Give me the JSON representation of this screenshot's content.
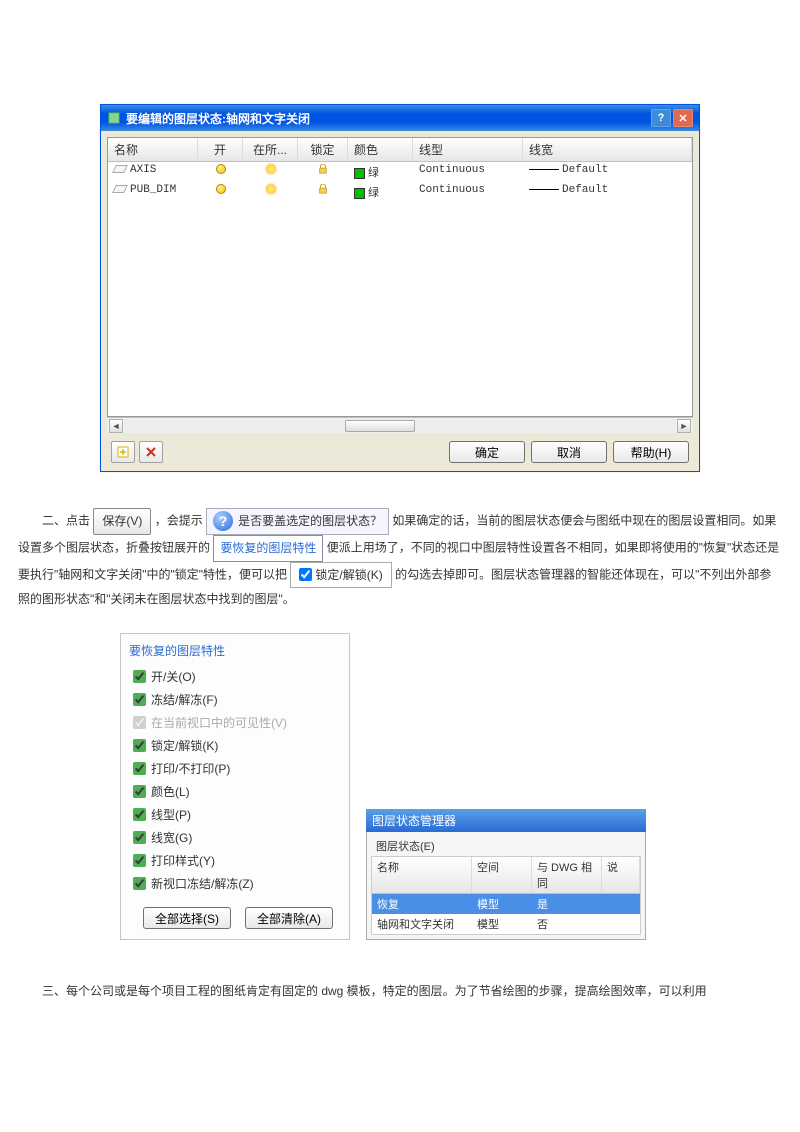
{
  "dialog": {
    "title": "要编辑的图层状态:轴网和文字关闭",
    "columns": {
      "name": "名称",
      "on": "开",
      "freeze": "在所...",
      "lock": "锁定",
      "color": "颜色",
      "linetype": "线型",
      "lineweight": "线宽"
    },
    "rows": [
      {
        "name": "AXIS",
        "color_label": "绿",
        "linetype": "Continuous",
        "lineweight": "Default"
      },
      {
        "name": "PUB_DIM",
        "color_label": "绿",
        "linetype": "Continuous",
        "lineweight": "Default"
      }
    ],
    "buttons": {
      "ok": "确定",
      "cancel": "取消",
      "help": "帮助(H)"
    }
  },
  "para2": {
    "prefix": "二、点击",
    "save_btn": "保存(V)",
    "t1": "，会提示",
    "prompt": "是否要盖选定的图层状态？",
    "t2": "如果确定的话，当前的图层状态便会与图纸中现在的图层设置相同。如果设置多个图层状态，折叠按钮展开的",
    "link1": "要恢复的图层特性",
    "t3": "便派上用场了，不同的视口中图层特性设置各不相同，如果即将使用的\"恢复\"状态还是要执行\"轴网和文字关闭\"中的\"锁定\"特性，便可以把",
    "chk_label": "锁定/解锁(K)",
    "t4": "的勾选去掉即可。图层状态管理器的智能还体现在，可以\"不列出外部参照的图形状态\"和\"关闭未在图层状态中找到的图层\"。"
  },
  "props": {
    "title": "要恢复的图层特性",
    "items": [
      {
        "label": "开/关(O)",
        "checked": true
      },
      {
        "label": "冻结/解冻(F)",
        "checked": true
      },
      {
        "label": "在当前视口中的可见性(V)",
        "checked": true,
        "disabled": true
      },
      {
        "label": "锁定/解锁(K)",
        "checked": true
      },
      {
        "label": "打印/不打印(P)",
        "checked": true
      },
      {
        "label": "颜色(L)",
        "checked": true
      },
      {
        "label": "线型(P)",
        "checked": true
      },
      {
        "label": "线宽(G)",
        "checked": true
      },
      {
        "label": "打印样式(Y)",
        "checked": true
      },
      {
        "label": "新视口冻结/解冻(Z)",
        "checked": true
      }
    ],
    "select_all": "全部选择(S)",
    "clear_all": "全部清除(A)"
  },
  "mgr": {
    "title": "图层状态管理器",
    "group": "图层状态(E)",
    "cols": {
      "name": "名称",
      "space": "空间",
      "same": "与 DWG 相同",
      "desc": "说"
    },
    "rows": [
      {
        "name": "恢复",
        "space": "模型",
        "same": "是",
        "sel": true
      },
      {
        "name": "轴网和文字关闭",
        "space": "模型",
        "same": "否",
        "sel": false
      }
    ]
  },
  "para3": "三、每个公司或是每个项目工程的图纸肯定有固定的 dwg 模板，特定的图层。为了节省绘图的步骤，提高绘图效率，可以利用"
}
